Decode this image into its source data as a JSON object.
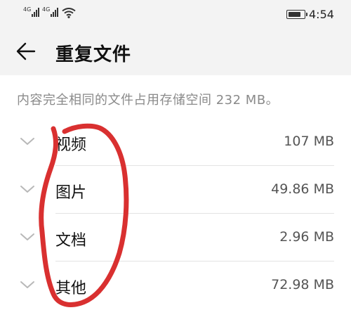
{
  "status_bar": {
    "signal1_label": "4G",
    "signal2_label": "4G",
    "time": "4:54",
    "battery_level": 0.8
  },
  "header": {
    "title": "重复文件",
    "back_icon": "back-arrow-icon"
  },
  "description": "内容完全相同的文件占用存储空间 232 MB。",
  "categories": [
    {
      "name": "视频",
      "size": "107 MB"
    },
    {
      "name": "图片",
      "size": "49.86 MB"
    },
    {
      "name": "文档",
      "size": "2.96 MB"
    },
    {
      "name": "其他",
      "size": "72.98 MB"
    }
  ],
  "annotation_color": "#d93030"
}
